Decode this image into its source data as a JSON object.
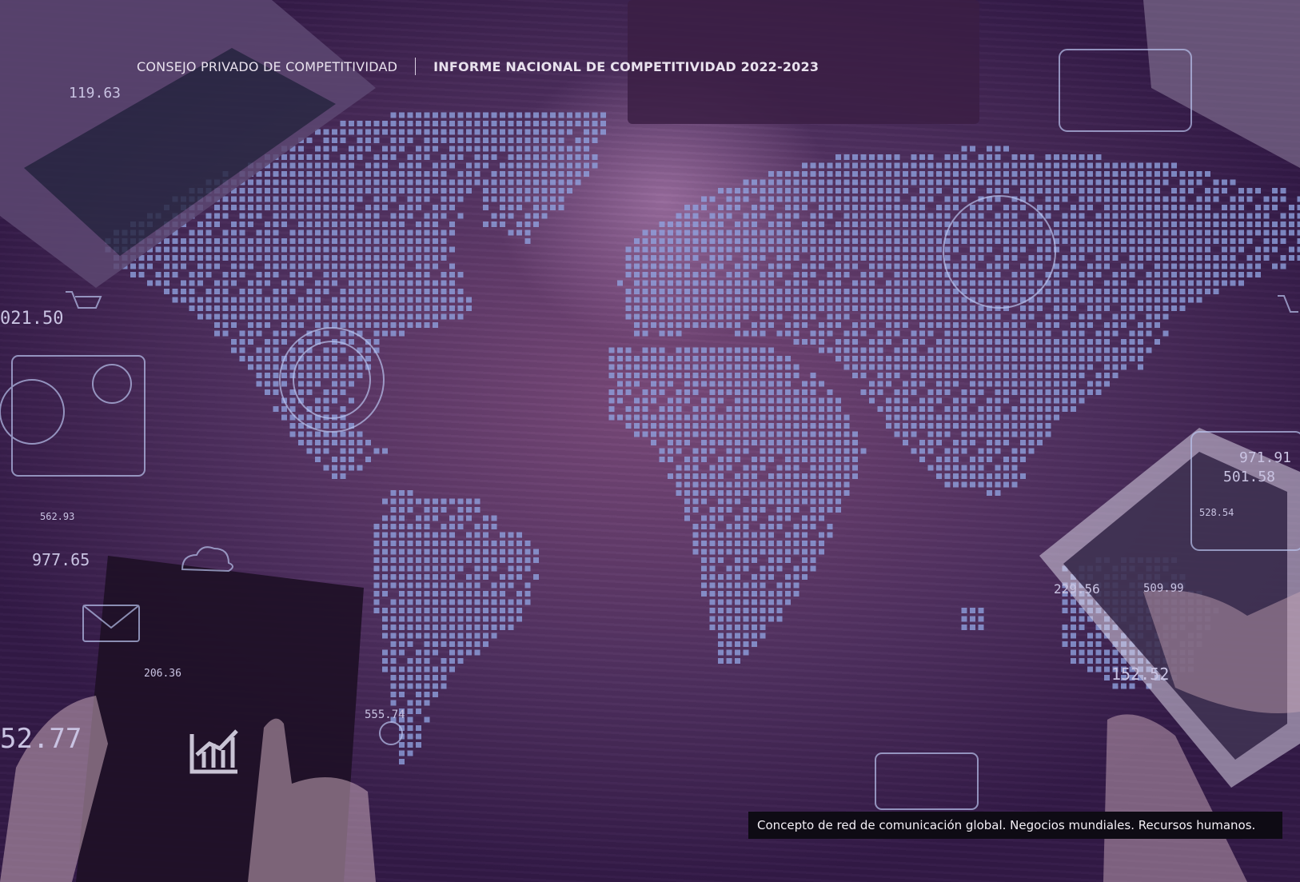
{
  "header": {
    "org": "CONSEJO PRIVADO DE COMPETITIVIDAD",
    "report": "INFORME NACIONAL DE COMPETITIVIDAD 2022-2023"
  },
  "photo": {
    "caption": "Concepto de red de comunicación global. Negocios mundiales. Recursos humanos.",
    "overlay_numbers": [
      "119.63",
      "021.50",
      "977.65",
      "52.77",
      "206.36",
      "555.74",
      "971.91",
      "501.58",
      "229.56",
      "509.99",
      "152.52",
      "562.93",
      "528.54"
    ]
  },
  "colors": {
    "tint": "#5a3668",
    "map_dots": "#8fa3e0",
    "caption_bg": "#0e0b14"
  }
}
